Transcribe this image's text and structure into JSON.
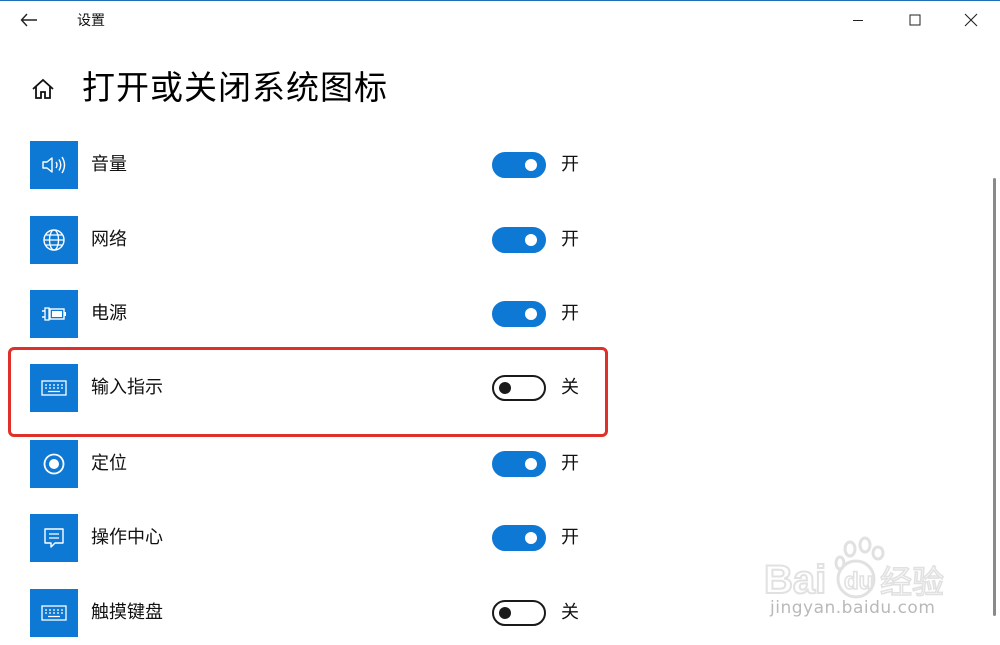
{
  "window": {
    "title": "设置"
  },
  "page": {
    "title": "打开或关闭系统图标"
  },
  "icons": {
    "back": "back-arrow-icon",
    "minimize": "minimize-icon",
    "maximize": "maximize-icon",
    "close": "close-icon",
    "home": "home-icon"
  },
  "colors": {
    "accent": "#0e78d5",
    "highlight": "#e0302a"
  },
  "items": [
    {
      "label": "音量",
      "icon": "volume-icon",
      "on": true,
      "state": "开"
    },
    {
      "label": "网络",
      "icon": "globe-icon",
      "on": true,
      "state": "开"
    },
    {
      "label": "电源",
      "icon": "battery-plug-icon",
      "on": true,
      "state": "开"
    },
    {
      "label": "输入指示",
      "icon": "keyboard-icon",
      "on": false,
      "state": "关"
    },
    {
      "label": "定位",
      "icon": "location-icon",
      "on": true,
      "state": "开"
    },
    {
      "label": "操作中心",
      "icon": "action-center-icon",
      "on": true,
      "state": "开"
    },
    {
      "label": "触摸键盘",
      "icon": "touch-keyboard-icon",
      "on": false,
      "state": "关"
    }
  ],
  "watermark": {
    "url": "jingyan.baidu.com"
  }
}
